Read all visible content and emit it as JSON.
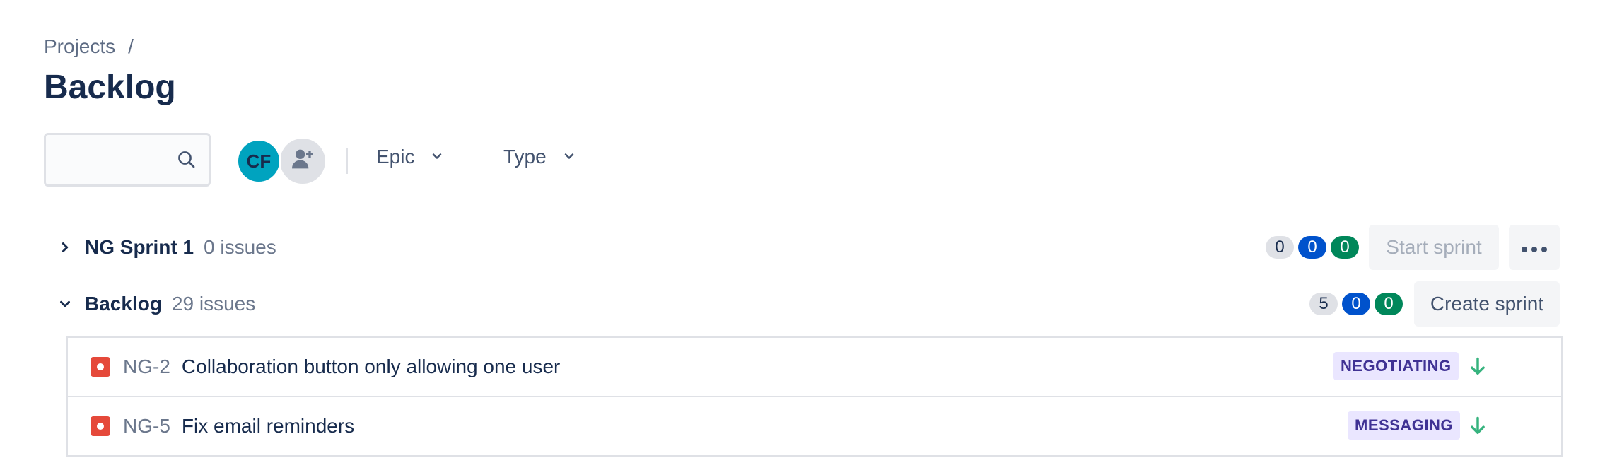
{
  "breadcrumb": {
    "projects": "Projects",
    "separator": "/"
  },
  "page_title": "Backlog",
  "search": {
    "value": "",
    "placeholder": ""
  },
  "avatars": [
    {
      "initials": "CF",
      "color": "#00a3bf"
    }
  ],
  "filters": {
    "epic": "Epic",
    "type": "Type"
  },
  "sprint": {
    "name": "NG Sprint 1",
    "count": "0 issues",
    "counts": [
      "0",
      "0",
      "0"
    ],
    "start_label": "Start sprint"
  },
  "backlog": {
    "name": "Backlog",
    "count": "29 issues",
    "counts": [
      "5",
      "0",
      "0"
    ],
    "create_label": "Create sprint"
  },
  "issues": [
    {
      "key": "NG-2",
      "summary": "Collaboration button only allowing one user",
      "epic": "NEGOTIATING",
      "priority": "low"
    },
    {
      "key": "NG-5",
      "summary": "Fix email reminders",
      "epic": "MESSAGING",
      "priority": "low"
    }
  ],
  "colors": {
    "accent": "#0052cc",
    "done": "#00875a",
    "bug": "#e5493a",
    "epic_bg": "#eae6ff",
    "epic_text": "#403294",
    "priority_low": "#36b37e"
  }
}
